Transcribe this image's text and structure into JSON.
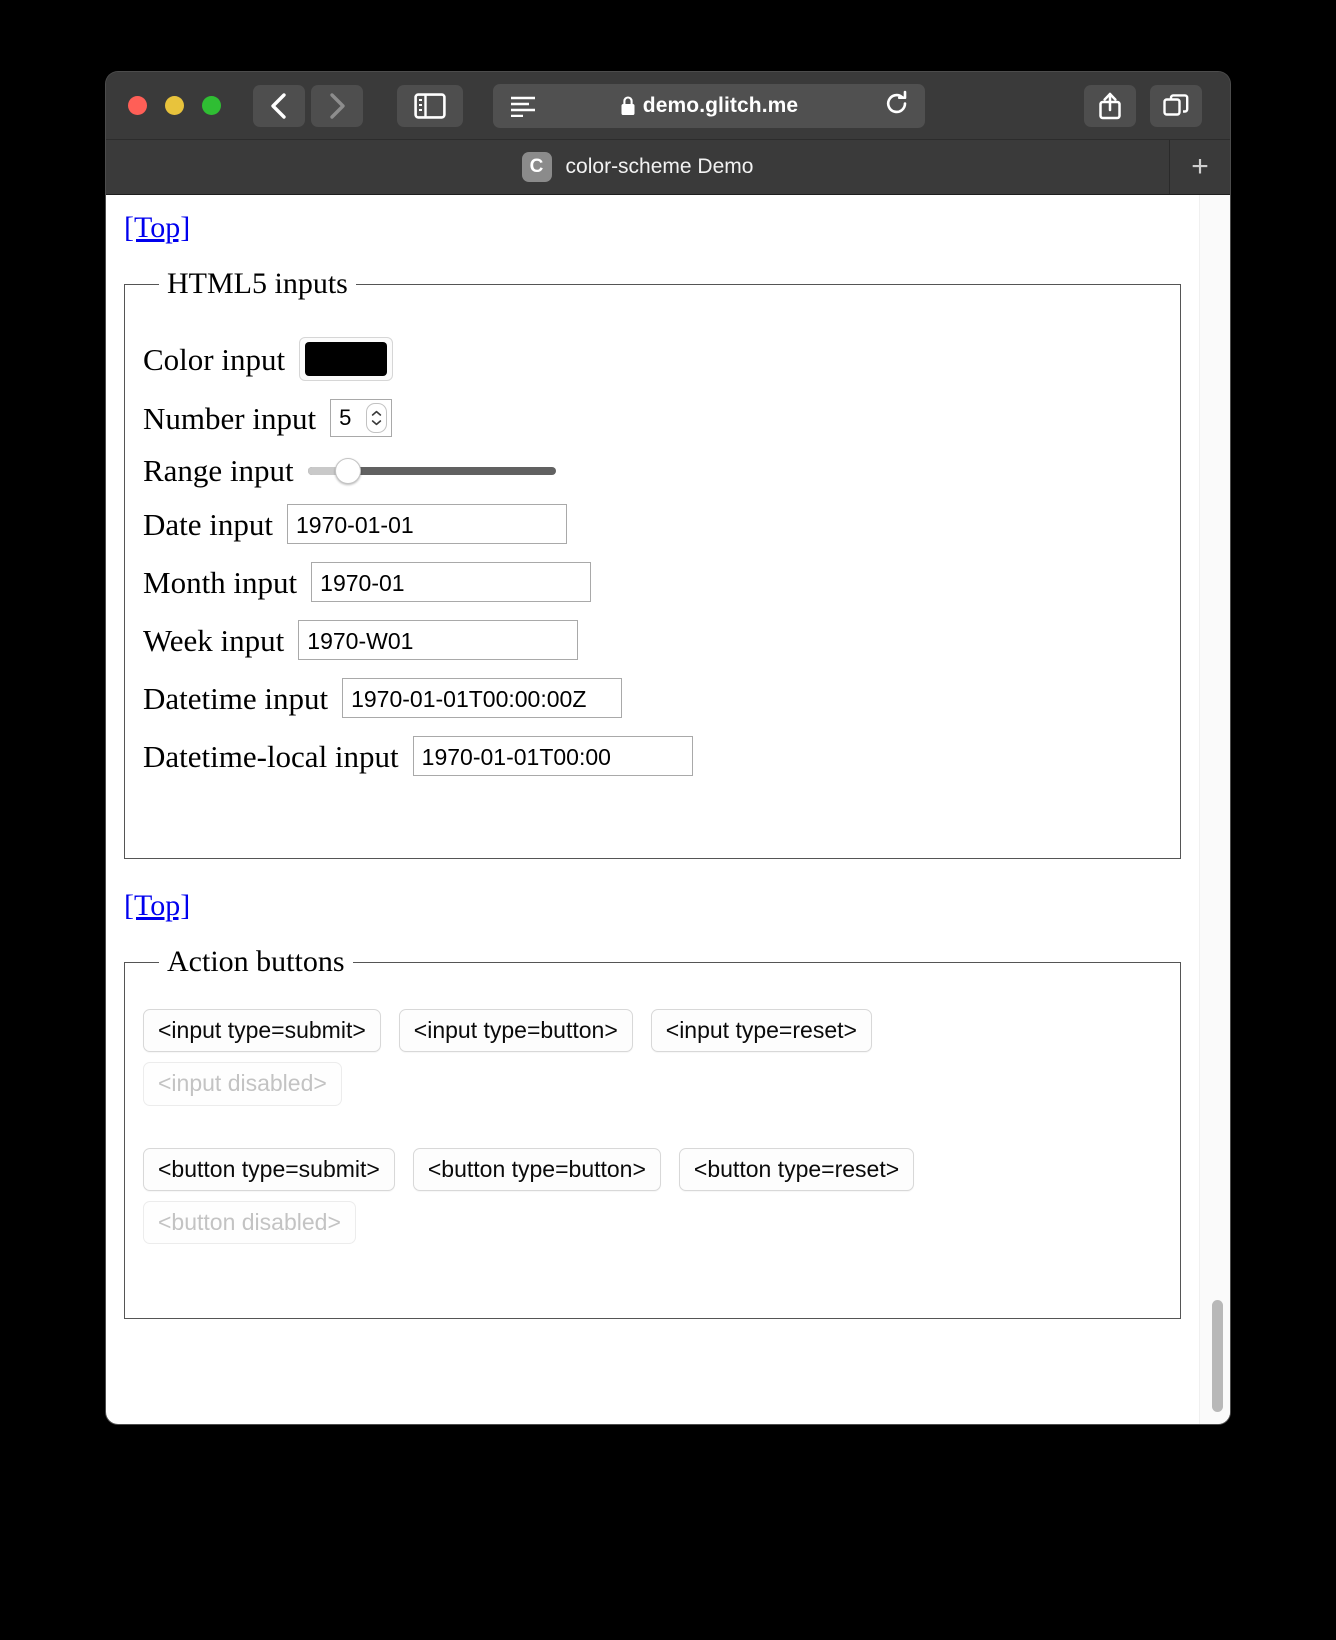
{
  "browser": {
    "window_controls": [
      "close",
      "minimize",
      "maximize"
    ],
    "back_label": "‹",
    "forward_label": "›",
    "sidebar_icon": "sidebar-icon",
    "reader_icon": "reader-view-icon",
    "lock_icon": "lock-icon",
    "url": "demo.glitch.me",
    "reload_icon": "reload-icon",
    "share_icon": "share-icon",
    "tabs_icon": "tab-overview-icon",
    "new_tab_label": "+",
    "tab": {
      "favicon_letter": "C",
      "title": "color-scheme Demo"
    }
  },
  "page": {
    "top_link_1": "[Top]",
    "top_link_2": "[Top]",
    "html5_inputs": {
      "legend": "HTML5 inputs",
      "fields": [
        {
          "label": "Color input",
          "type": "color",
          "value": "#000000"
        },
        {
          "label": "Number input",
          "type": "number",
          "value": "5"
        },
        {
          "label": "Range input",
          "type": "range",
          "value": "15",
          "min": "0",
          "max": "100"
        },
        {
          "label": "Date input",
          "type": "date",
          "value": "1970-01-01"
        },
        {
          "label": "Month input",
          "type": "month",
          "value": "1970-01"
        },
        {
          "label": "Week input",
          "type": "week",
          "value": "1970-W01"
        },
        {
          "label": "Datetime input",
          "type": "datetime",
          "value": "1970-01-01T00:00:00Z"
        },
        {
          "label": "Datetime-local input",
          "type": "datetime-local",
          "value": "1970-01-01T00:00"
        }
      ]
    },
    "action_buttons": {
      "legend": "Action buttons",
      "input_row": [
        "<input type=submit>",
        "<input type=button>",
        "<input type=reset>"
      ],
      "input_disabled": "<input disabled>",
      "button_row": [
        "<button type=submit>",
        "<button type=button>",
        "<button type=reset>"
      ],
      "button_disabled": "<button disabled>"
    }
  },
  "colors": {
    "link": "#0000ee",
    "color_input_value": "#000000",
    "fieldset_border": "#555555",
    "chrome_bg": "#3a3a3a",
    "page_bg": "#ffffff"
  }
}
